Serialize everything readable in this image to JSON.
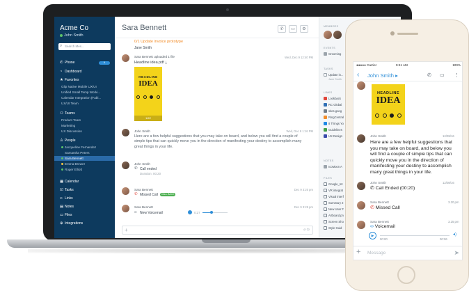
{
  "sidebar": {
    "company": "Acme Co",
    "user": "John Smith",
    "search_placeholder": "Search Mes...",
    "nav": {
      "phone": "Phone",
      "phone_badge": "9",
      "dashboard": "Dashboard",
      "favorites": "Favorites",
      "teams": "Teams",
      "people": "People",
      "calendar": "Calendar",
      "tasks": "Tasks",
      "links": "Links",
      "notes": "Notes",
      "files": "Files",
      "integrations": "Integrations"
    },
    "favorites": [
      "Glip Native Mobile UX/UI",
      "Unified Small Temp Worki...",
      "Calendar Integration (Fabl...",
      "UX/UI Team"
    ],
    "teams": [
      "Product Team",
      "Marketing",
      "UX Discussion"
    ],
    "people": [
      "Jacqueline Fernandez",
      "Samantha Peters",
      "Sara Bennett",
      "Emma Brewer",
      "Roger Elliott"
    ]
  },
  "conversation": {
    "title": "Sara Bennett",
    "pinned": "0/1 Update invoice prototype",
    "pinned_author": "Jane Smith",
    "file_event": "Sara Bennett uploaded 1 file",
    "file_time": "Wed, Dec 9 12:40 PM",
    "file_name": "Headline idea.pdf",
    "poster": {
      "small": "HEADLINE",
      "big": "IDEA",
      "bar": "1/22"
    },
    "messages": [
      {
        "author": "John Smith",
        "time": "Wed, Dec 9 1:16 PM",
        "text": [
          "Here are a few helpful suggestions that you may take on board, and below you will find a couple of",
          "simple tips that can quickly move you in the direction of manifesting your destiny to accomplish many",
          "great things in your life."
        ]
      },
      {
        "author": "John Smith",
        "time": "",
        "text": [
          "Call ended",
          "Duration: 00:20"
        ]
      },
      {
        "author": "Sara Bennett",
        "time": "Dec 9 3:20 pm",
        "text": [
          "Missed Call"
        ],
        "pill": "CALL BACK"
      },
      {
        "author": "Sara Bennett",
        "time": "Dec 9 3:25 pm",
        "text": [
          "New Voicemail"
        ],
        "duration": "0:27"
      }
    ]
  },
  "right_panel": {
    "members": "MEMBERS",
    "events": "EVENTS",
    "event_item": "Grooming",
    "tasks": "TASKS",
    "task_item": "Update in...",
    "task_sub": "Jane Smith",
    "links": "LINKS",
    "link_items": [
      "Lookback",
      "RC Global",
      "sites.goog",
      "RingCentral",
      "8 Things Yo",
      "Guidelines",
      "UX Design"
    ],
    "notes": "NOTES",
    "note_item": "IcoMoon A",
    "files": "FILES",
    "file_items": [
      "Google_Int",
      "VR integrat",
      "Visual interf",
      "Summary 2",
      "New User F",
      "Artboard.pn",
      "Screen Sho",
      "Style Guid"
    ]
  },
  "phone": {
    "carrier": "Carrier",
    "time": "9:41 AM",
    "battery": "100%",
    "contact": "John Smith",
    "messages": [
      {
        "author": "John Smith",
        "time": "12/09/16",
        "text": [
          "Here are a few helpful suggestions that",
          "you may take on board, and below you",
          "will find a couple of simple tips that can",
          "quickly move you in the direction of",
          "manifesting your destiny to accomplish",
          "many great things in your life."
        ]
      },
      {
        "author": "John Smith",
        "time": "12/08/16",
        "text": [
          "Call Ended (00:20)"
        ]
      },
      {
        "author": "Sara Bennett",
        "time": "3.20 pm",
        "text": [
          "Missed Call"
        ]
      },
      {
        "author": "Sara Bennett",
        "time": "3.25 pm",
        "text": [
          "Voicemail"
        ]
      }
    ],
    "voice_start": "00:00",
    "voice_end": "00:06",
    "composer_placeholder": "Message"
  }
}
